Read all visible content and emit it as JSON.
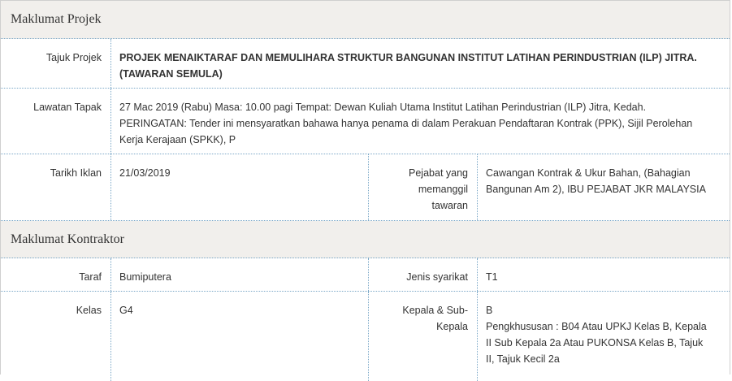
{
  "maklumat_projek": {
    "title": "Maklumat Projek",
    "tajuk_projek_label": "Tajuk Projek",
    "tajuk_projek_line1": "PROJEK MENAIKTARAF DAN MEMULIHARA STRUKTUR BANGUNAN INSTITUT LATIHAN PERINDUSTRIAN (ILP) JITRA.",
    "tajuk_projek_line2": "(TAWARAN SEMULA)",
    "lawatan_tapak_label": "Lawatan Tapak",
    "lawatan_tapak_line1": "27 Mac 2019 (Rabu) Masa: 10.00 pagi Tempat: Dewan Kuliah Utama Institut Latihan Perindustrian (ILP) Jitra, Kedah.",
    "lawatan_tapak_line2": "PERINGATAN: Tender ini mensyaratkan bahawa hanya penama di dalam Perakuan Pendaftaran Kontrak (PPK), Sijil Perolehan",
    "lawatan_tapak_line3": "Kerja Kerajaan (SPKK), P",
    "tarikh_iklan_label": "Tarikh Iklan",
    "tarikh_iklan_value": "21/03/2019",
    "pejabat_label_line1": "Pejabat yang",
    "pejabat_label_line2": "memanggil",
    "pejabat_label_line3": "tawaran",
    "pejabat_value_line1": "Cawangan Kontrak & Ukur Bahan, (Bahagian",
    "pejabat_value_line2": "Bangunan Am 2), IBU PEJABAT JKR MALAYSIA"
  },
  "maklumat_kontraktor": {
    "title": "Maklumat Kontraktor",
    "taraf_label": "Taraf",
    "taraf_value": "Bumiputera",
    "jenis_label": "Jenis syarikat",
    "jenis_value": "T1",
    "kelas_label": "Kelas",
    "kelas_value": "G4",
    "kepala_label_line1": "Kepala & Sub-",
    "kepala_label_line2": "Kepala",
    "kepala_value_line1": "B",
    "kepala_value_line2": "Pengkhususan : B04 Atau UPKJ Kelas B, Kepala",
    "kepala_value_line3": "II Sub Kepala 2a Atau PUKONSA Kelas B, Tajuk",
    "kepala_value_line4": "II, Tajuk Kecil 2a"
  }
}
